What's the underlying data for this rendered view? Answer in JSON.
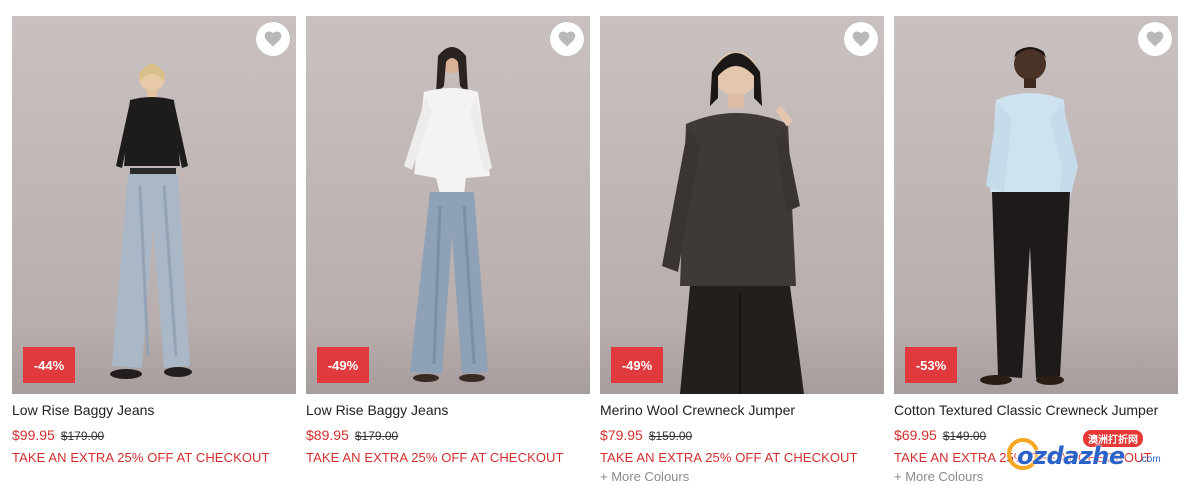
{
  "products": [
    {
      "name": "Low Rise Baggy Jeans",
      "price": "$99.95",
      "was_price": "$179.00",
      "discount": "-44%",
      "promo": "TAKE AN EXTRA 25% OFF AT CHECKOUT",
      "more_colours": ""
    },
    {
      "name": "Low Rise Baggy Jeans",
      "price": "$89.95",
      "was_price": "$179.00",
      "discount": "-49%",
      "promo": "TAKE AN EXTRA 25% OFF AT CHECKOUT",
      "more_colours": ""
    },
    {
      "name": "Merino Wool Crewneck Jumper",
      "price": "$79.95",
      "was_price": "$159.00",
      "discount": "-49%",
      "promo": "TAKE AN EXTRA 25% OFF AT CHECKOUT",
      "more_colours": "+ More Colours"
    },
    {
      "name": "Cotton Textured Classic Crewneck Jumper",
      "price": "$69.95",
      "was_price": "$149.00",
      "discount": "-53%",
      "promo": "TAKE AN EXTRA 25% OFF AT CHECKOUT",
      "more_colours": "+ More Colours"
    }
  ],
  "icons": {
    "wishlist": "heart-icon"
  },
  "colors": {
    "sale_red": "#d32f2f",
    "badge_red": "#e0393e"
  },
  "watermark": {
    "text": "ozdazhe",
    "domain": ".com",
    "tag": "澳洲打折网"
  }
}
